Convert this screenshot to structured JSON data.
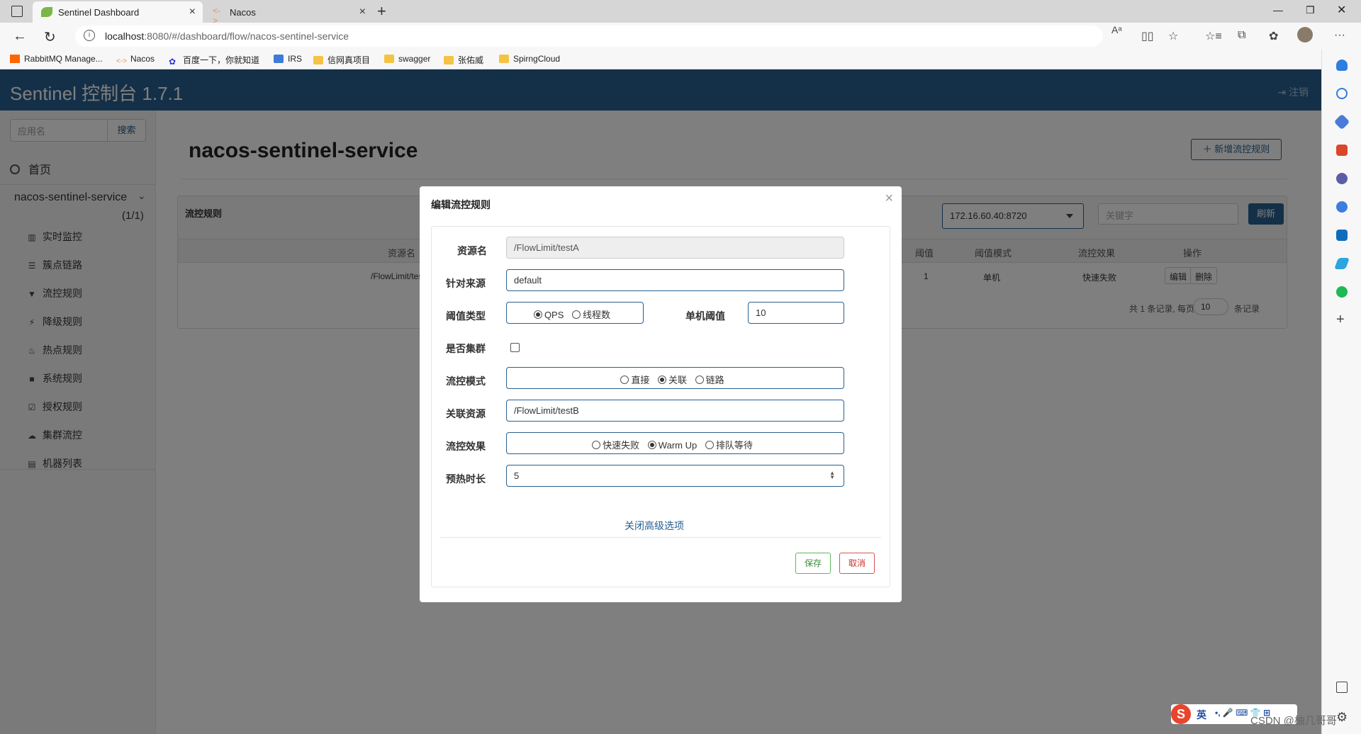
{
  "browser": {
    "tabs": [
      {
        "title": "Sentinel Dashboard",
        "active": true
      },
      {
        "title": "Nacos",
        "active": false
      }
    ],
    "url_host": "localhost",
    "url_rest": ":8080/#/dashboard/flow/nacos-sentinel-service",
    "bookmarks": [
      "RabbitMQ Manage...",
      "Nacos",
      "百度一下，你就知道",
      "IRS",
      "信网真项目",
      "swagger",
      "张佑威",
      "SpirngCloud"
    ]
  },
  "app": {
    "brand": "Sentinel 控制台 1.7.1",
    "logout": "注销",
    "search_placeholder": "应用名",
    "search_button": "搜索",
    "home": "首页",
    "service": "nacos-sentinel-service",
    "service_count": "(1/1)",
    "nav_items": [
      "实时监控",
      "簇点链路",
      "流控规则",
      "降级规则",
      "热点规则",
      "系统规则",
      "授权规则",
      "集群流控",
      "机器列表"
    ],
    "page_title": "nacos-sentinel-service",
    "add_rule": "新增流控规则",
    "panel_title": "流控规则",
    "machine": "172.16.60.40:8720",
    "keyword_placeholder": "关键字",
    "refresh": "刷新",
    "table": {
      "headers": [
        "资源名",
        "阈值",
        "阈值模式",
        "流控效果",
        "操作"
      ],
      "row": {
        "resource": "/FlowLimit/testA",
        "threshold": "1",
        "mode": "单机",
        "effect": "快速失败",
        "edit": "编辑",
        "delete": "删除"
      }
    },
    "pager": {
      "prefix": "共 1 条记录, 每页",
      "page_size": "10",
      "suffix": "条记录"
    }
  },
  "modal": {
    "title": "编辑流控规则",
    "labels": {
      "resource": "资源名",
      "origin": "针对来源",
      "grade": "阈值类型",
      "single_threshold": "单机阈值",
      "cluster": "是否集群",
      "strategy": "流控模式",
      "ref_resource": "关联资源",
      "behavior": "流控效果",
      "warmup": "预热时长"
    },
    "values": {
      "resource": "/FlowLimit/testA",
      "origin": "default",
      "single_threshold": "10",
      "ref_resource": "/FlowLimit/testB",
      "warmup": "5"
    },
    "grade_options": [
      "QPS",
      "线程数"
    ],
    "grade_selected": "QPS",
    "strategy_options": [
      "直接",
      "关联",
      "链路"
    ],
    "strategy_selected": "关联",
    "behavior_options": [
      "快速失败",
      "Warm Up",
      "排队等待"
    ],
    "behavior_selected": "Warm Up",
    "cluster_checked": false,
    "advanced_link": "关闭高级选项",
    "save": "保存",
    "cancel": "取消"
  },
  "system": {
    "ime_label": "英",
    "watermark": "CSDN @柚几哥哥"
  },
  "colors": {
    "primary": "#286090",
    "save": "#5cb85c",
    "cancel": "#d9534f"
  }
}
